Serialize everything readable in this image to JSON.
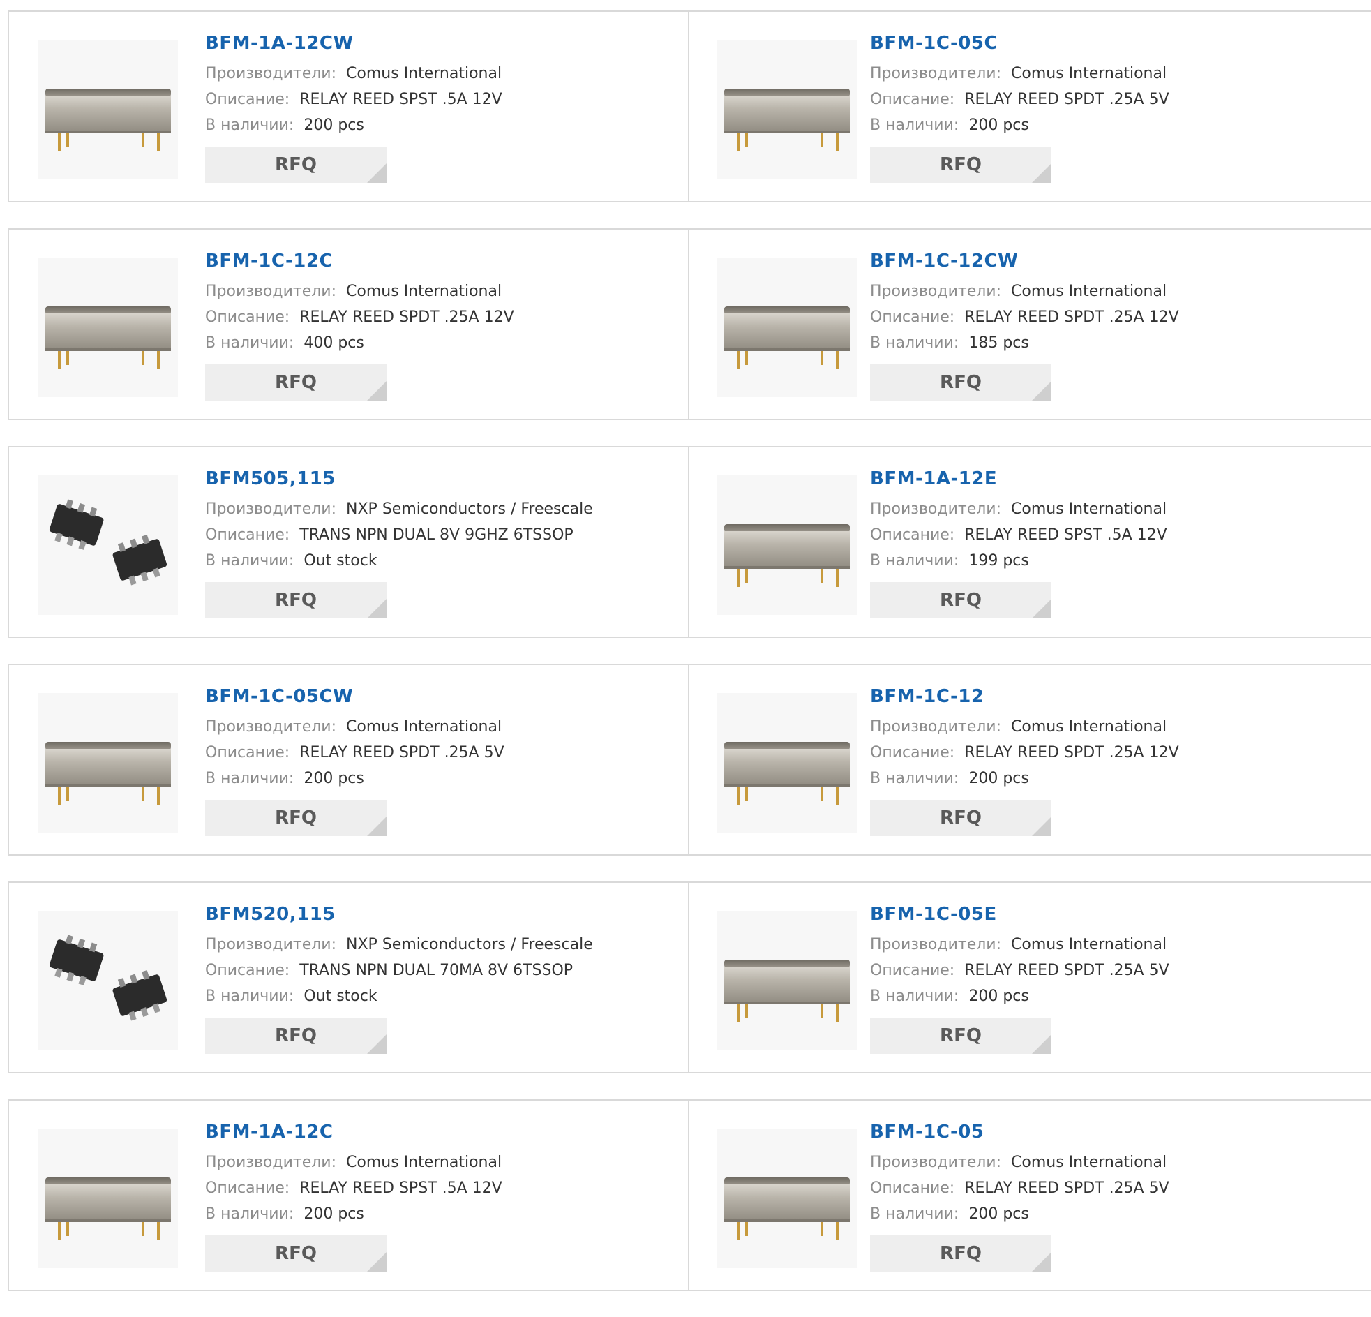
{
  "labels": {
    "manufacturer": "Производители:",
    "description": "Описание:",
    "stock": "В наличии:",
    "rfq": "RFQ"
  },
  "products": [
    {
      "name": "BFM-1A-12CW",
      "manufacturer": "Comus International",
      "description": "RELAY REED SPST .5A 12V",
      "stock": "200 pcs",
      "image": "reed-relay"
    },
    {
      "name": "BFM-1C-05C",
      "manufacturer": "Comus International",
      "description": "RELAY REED SPDT .25A 5V",
      "stock": "200 pcs",
      "image": "reed-relay"
    },
    {
      "name": "BFM-1C-12C",
      "manufacturer": "Comus International",
      "description": "RELAY REED SPDT .25A 12V",
      "stock": "400 pcs",
      "image": "reed-relay"
    },
    {
      "name": "BFM-1C-12CW",
      "manufacturer": "Comus International",
      "description": "RELAY REED SPDT .25A 12V",
      "stock": "185 pcs",
      "image": "reed-relay"
    },
    {
      "name": "BFM505,115",
      "manufacturer": "NXP Semiconductors / Freescale",
      "description": "TRANS NPN DUAL 8V 9GHZ 6TSSOP",
      "stock": "Out stock",
      "image": "tssop-chip"
    },
    {
      "name": "BFM-1A-12E",
      "manufacturer": "Comus International",
      "description": "RELAY REED SPST .5A 12V",
      "stock": "199 pcs",
      "image": "reed-relay"
    },
    {
      "name": "BFM-1C-05CW",
      "manufacturer": "Comus International",
      "description": "RELAY REED SPDT .25A 5V",
      "stock": "200 pcs",
      "image": "reed-relay"
    },
    {
      "name": "BFM-1C-12",
      "manufacturer": "Comus International",
      "description": "RELAY REED SPDT .25A 12V",
      "stock": "200 pcs",
      "image": "reed-relay"
    },
    {
      "name": "BFM520,115",
      "manufacturer": "NXP Semiconductors / Freescale",
      "description": "TRANS NPN DUAL 70MA 8V 6TSSOP",
      "stock": "Out stock",
      "image": "tssop-chip"
    },
    {
      "name": "BFM-1C-05E",
      "manufacturer": "Comus International",
      "description": "RELAY REED SPDT .25A 5V",
      "stock": "200 pcs",
      "image": "reed-relay"
    },
    {
      "name": "BFM-1A-12C",
      "manufacturer": "Comus International",
      "description": "RELAY REED SPST .5A 12V",
      "stock": "200 pcs",
      "image": "reed-relay"
    },
    {
      "name": "BFM-1C-05",
      "manufacturer": "Comus International",
      "description": "RELAY REED SPDT .25A 5V",
      "stock": "200 pcs",
      "image": "reed-relay"
    }
  ],
  "colors": {
    "title_link": "#1763ad",
    "label_text": "#8c8c8c",
    "value_text": "#333333",
    "rfq_bg": "#eeeeee",
    "rfq_corner": "#cfcfcf",
    "border": "#d9d9d9"
  }
}
